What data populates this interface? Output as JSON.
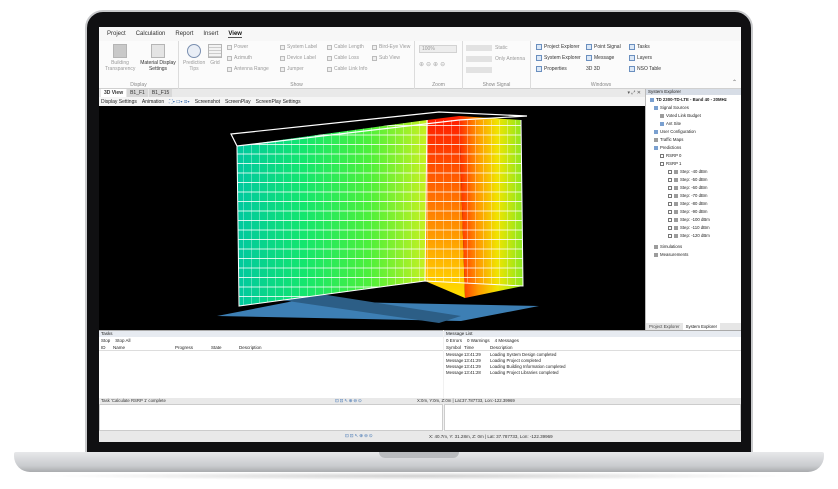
{
  "ribbon": {
    "tabs": [
      "Project",
      "Calculation",
      "Report",
      "Insert",
      "View"
    ],
    "active_tab": "View",
    "display_group": {
      "name": "Display",
      "building_transparency": "Building Transparency",
      "material_display_settings": "Material Display Settings"
    },
    "show_group": {
      "name": "Show",
      "prediction_tips": "Prediction Tips",
      "grid": "Grid",
      "power": "Power",
      "azimuth": "Azimuth",
      "antenna_range": "Antenna Range",
      "system_label": "System Label",
      "device_label": "Device Label",
      "jumper": "Jumper",
      "cable_length": "Cable Length",
      "cable_loss": "Cable Loss",
      "cable_link_info": "Cable Link Info",
      "birds_eye_view": "Bird-Eye View",
      "sub_view": "Sub View"
    },
    "zoom_group": {
      "name": "Zoom",
      "level": "100%"
    },
    "show_signal_group": {
      "name": "Show Signal",
      "static": "Static",
      "only_antenna": "Only Antenna"
    },
    "windows_group": {
      "name": "Windows",
      "project_explorer": "Project Explorer",
      "system_explorer": "System Explorer",
      "properties": "Properties",
      "point_signal": "Point Signal",
      "message": "Message",
      "three_d": "3D 3D",
      "tasks": "Tasks",
      "layers": "Layers",
      "nso_table": "NSO Table"
    }
  },
  "view_tabs": [
    "3D View",
    "B1_F1",
    "B1_F15"
  ],
  "view_toolbar": [
    "Display Settings",
    "Animation",
    "Screenshot",
    "ScreenPlay",
    "ScreenPlay Settings"
  ],
  "explorer": {
    "title": "System Explorer",
    "root": "TD 2300-TD-LTE - Band 40 - 20MHz",
    "items": [
      "Signal Sources",
      "Voted Link Budget",
      "Ant Site",
      "User Configuration",
      "Traffic Maps",
      "Predictions",
      "RSRP 0",
      "RSRP 1"
    ],
    "steps": [
      "Step: -40 dBm",
      "Step: -50 dBm",
      "Step: -60 dBm",
      "Step: -70 dBm",
      "Step: -80 dBm",
      "Step: -90 dBm",
      "Step: -100 dBm",
      "Step: -110 dBm",
      "Step: -120 dBm"
    ],
    "tail": [
      "Simulations",
      "Measurements"
    ],
    "tabs": [
      "Project Explorer",
      "System Explorer"
    ]
  },
  "tasks": {
    "title": "Tasks",
    "toolbar": [
      "Stop",
      "Stop All"
    ],
    "columns": [
      "ID",
      "Name",
      "Progress",
      "State",
      "Description"
    ],
    "status": "Task 'Calculate RSRP 1' complete"
  },
  "messages": {
    "title": "Message List",
    "filters": [
      "0 Errors",
      "0 Warnings",
      "4 Messages"
    ],
    "columns": [
      "Symbol",
      "Time",
      "Description"
    ],
    "rows": [
      {
        "symbol": "Message",
        "time": "13:41:29",
        "description": "Loading System Design completed"
      },
      {
        "symbol": "Message",
        "time": "13:41:29",
        "description": "Loading Project completed"
      },
      {
        "symbol": "Message",
        "time": "13:41:29",
        "description": "Loading Building Information completed"
      },
      {
        "symbol": "Message",
        "time": "13:41:28",
        "description": "Loading Project Libraries completed"
      }
    ]
  },
  "status_bar": {
    "mid_coords": "X:0m, Y:0m, Z:0m | Lat:37.787733, Lon:-122.39969",
    "coords": "X: 40.7m, Y: 31.28m, Z: 0m | Lat: 37.787733, Lon: -122.39969"
  }
}
